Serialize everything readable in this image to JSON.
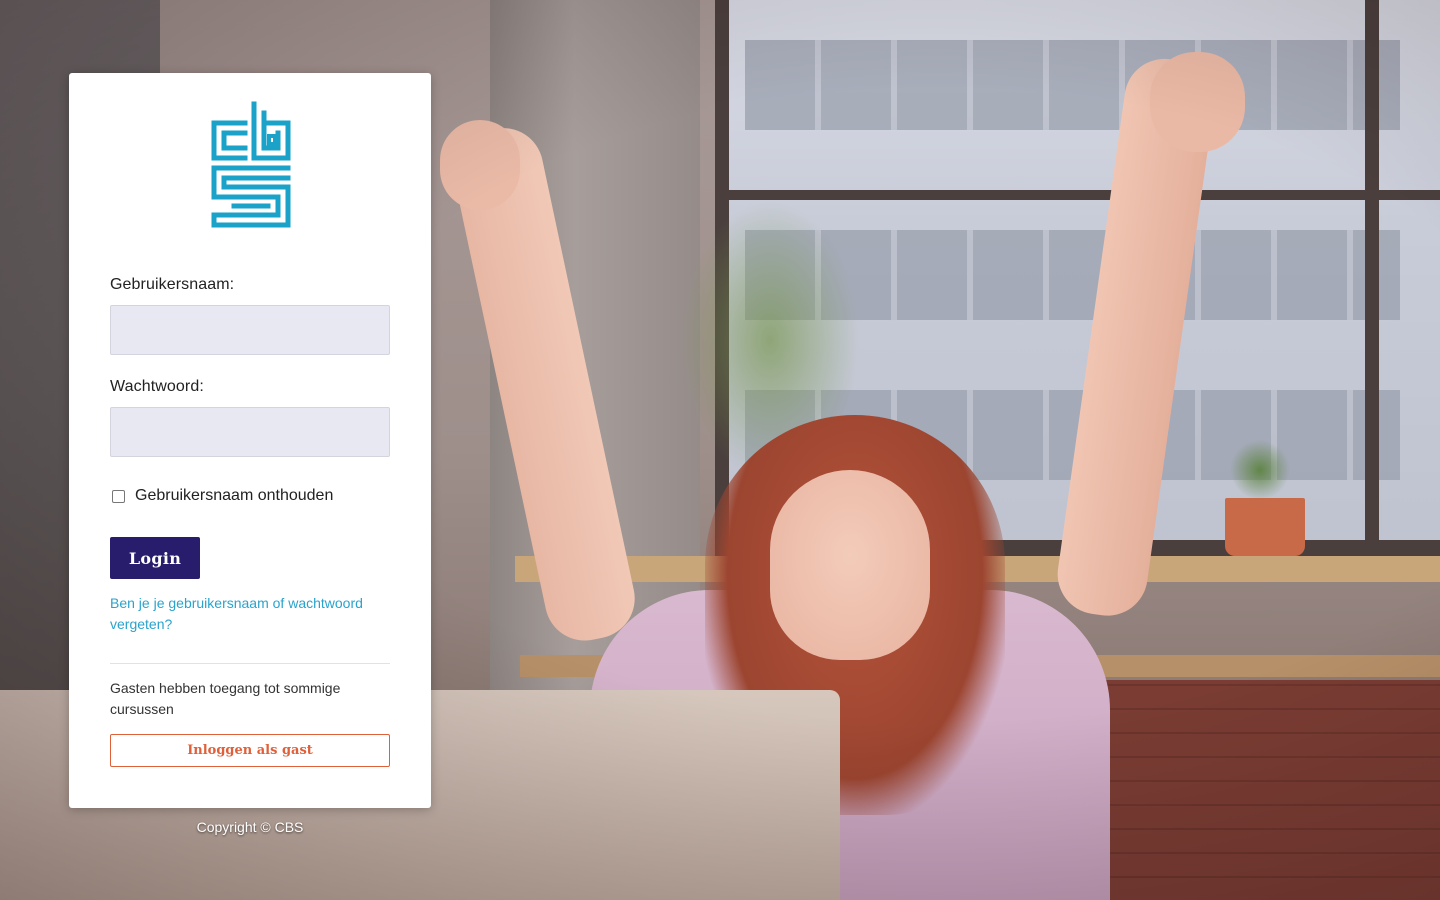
{
  "brand": {
    "logo_icon": "cbs-logo-icon",
    "logo_color": "#1aa2c9"
  },
  "form": {
    "username_label": "Gebruikersnaam:",
    "username_value": "",
    "password_label": "Wachtwoord:",
    "password_value": "",
    "remember_label": "Gebruikersnaam onthouden",
    "remember_checked": false,
    "login_button": "Login",
    "forgot_link": "Ben je je gebruikersnaam of wachtwoord vergeten?"
  },
  "guest": {
    "note": "Gasten hebben toegang tot sommige cursussen",
    "button": "Inloggen als gast"
  },
  "footer": {
    "copyright": "Copyright © CBS"
  },
  "colors": {
    "primary_button": "#271d6c",
    "link": "#2aa3cc",
    "guest_accent": "#e0603a",
    "input_bg": "#e8e8f3"
  }
}
